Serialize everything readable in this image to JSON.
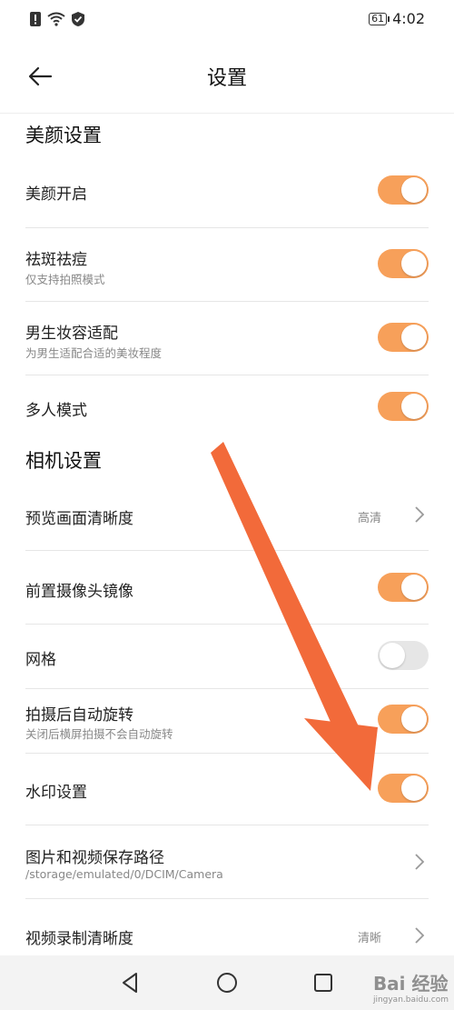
{
  "status_bar": {
    "battery": "61",
    "time": "4:02"
  },
  "header": {
    "title": "设置"
  },
  "beauty_section": {
    "title": "美颜设置",
    "items": [
      {
        "label": "美颜开启",
        "subtitle": "",
        "on": true
      },
      {
        "label": "祛斑祛痘",
        "subtitle": "仅支持拍照模式",
        "on": true
      },
      {
        "label": "男生妆容适配",
        "subtitle": "为男生适配合适的美妆程度",
        "on": true
      },
      {
        "label": "多人模式",
        "subtitle": "",
        "on": true
      }
    ]
  },
  "camera_section": {
    "title": "相机设置",
    "preview_clarity": {
      "label": "预览画面清晰度",
      "value": "高清"
    },
    "front_mirror": {
      "label": "前置摄像头镜像",
      "on": true
    },
    "grid": {
      "label": "网格",
      "on": false
    },
    "auto_rotate": {
      "label": "拍摄后自动旋转",
      "subtitle": "关闭后横屏拍摄不会自动旋转",
      "on": true
    },
    "watermark": {
      "label": "水印设置",
      "on": true
    },
    "save_path": {
      "label": "图片和视频保存路径",
      "subtitle": "/storage/emulated/0/DCIM/Camera"
    },
    "video_clarity": {
      "label": "视频录制清晰度",
      "value": "清晰"
    }
  },
  "overlay": {
    "watermark_text": "Bai 经验",
    "watermark_sub": "jingyan.baidu.com"
  },
  "colors": {
    "accent": "#f7a05a",
    "arrow": "#f26a3a"
  }
}
